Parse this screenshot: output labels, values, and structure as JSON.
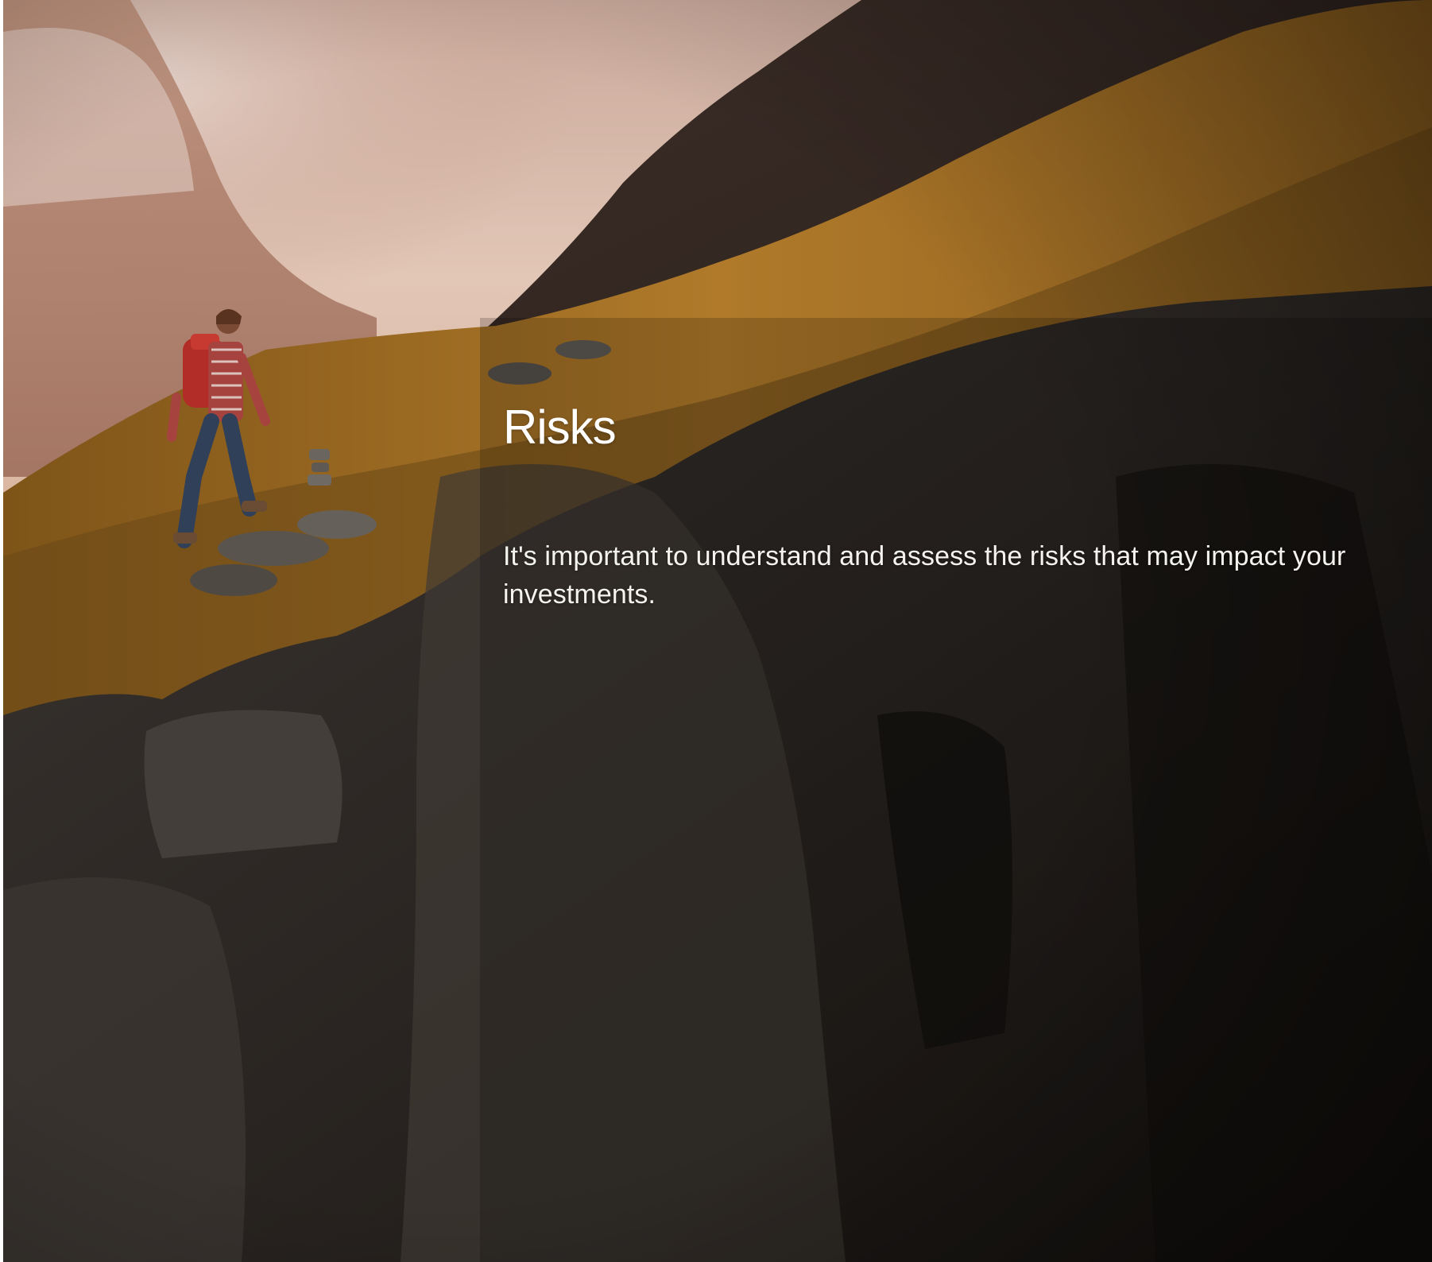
{
  "hero": {
    "image_description_icon": "mountain-hiker-photo",
    "title": "Risks",
    "body": "It's important to understand and assess the risks that may impact your investments."
  },
  "colors": {
    "text": "#ffffff",
    "sky": "#d9b8a8",
    "grass": "#9a6a24",
    "rock": "#2a2522"
  }
}
